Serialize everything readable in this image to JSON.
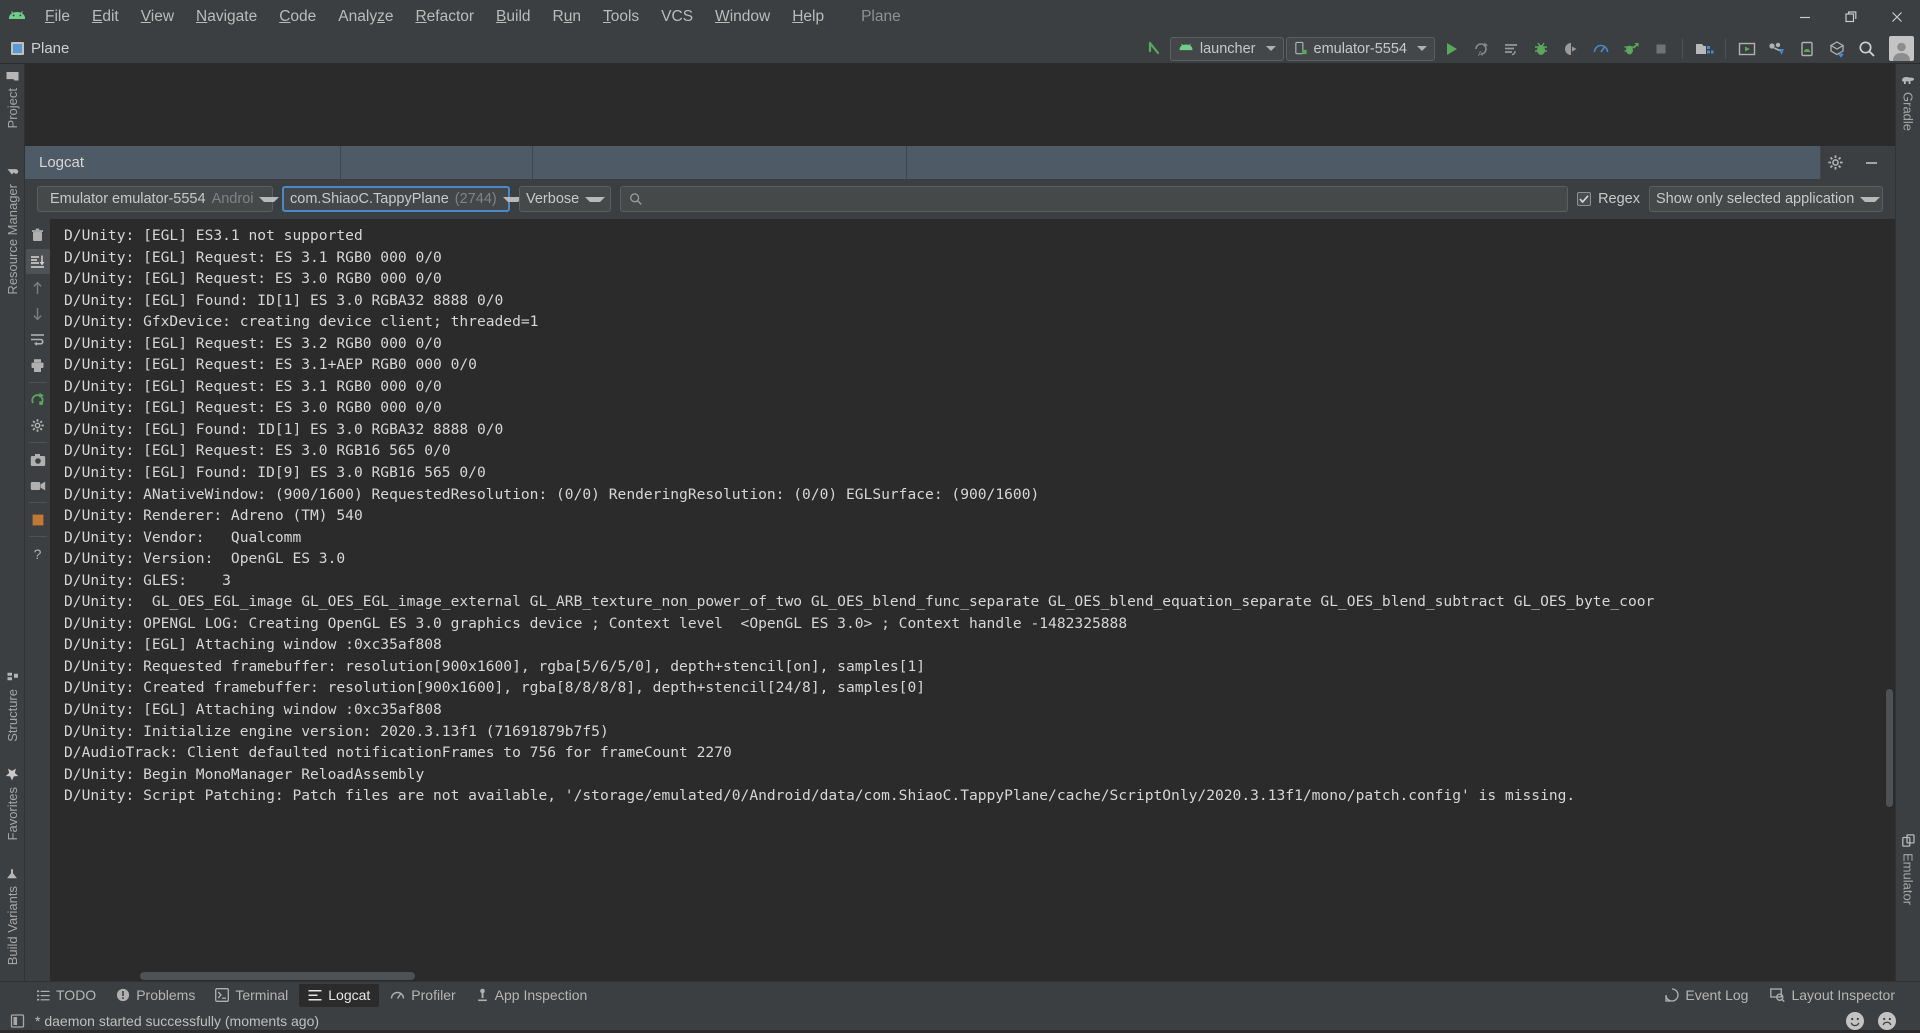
{
  "window": {
    "app_icon": "android-logo-icon",
    "ghost_title": "Plane",
    "controls": {
      "minimize": "minimize-icon",
      "maximize": "restore-icon",
      "close": "close-icon"
    }
  },
  "menubar": {
    "items": [
      {
        "label": "File",
        "mnemonic": "F"
      },
      {
        "label": "Edit",
        "mnemonic": "E"
      },
      {
        "label": "View",
        "mnemonic": "V"
      },
      {
        "label": "Navigate",
        "mnemonic": "N"
      },
      {
        "label": "Code",
        "mnemonic": "C"
      },
      {
        "label": "Analyze",
        "mnemonic": "z"
      },
      {
        "label": "Refactor",
        "mnemonic": "R"
      },
      {
        "label": "Build",
        "mnemonic": "B"
      },
      {
        "label": "Run",
        "mnemonic": "u"
      },
      {
        "label": "Tools",
        "mnemonic": "T"
      },
      {
        "label": "VCS",
        "mnemonic": ""
      },
      {
        "label": "Window",
        "mnemonic": "W"
      },
      {
        "label": "Help",
        "mnemonic": "H"
      }
    ]
  },
  "navbar": {
    "breadcrumb": "Plane",
    "run_config": "launcher",
    "device": "emulator-5554",
    "icons": [
      "back-arrow-icon",
      "run-icon",
      "apply-changes-icon",
      "apply-code-changes-icon",
      "debug-icon",
      "attach-debugger-icon",
      "profiler-icon",
      "run-with-coverage-icon",
      "stop-icon",
      "sdk-manager-icon",
      "avd-manager-icon",
      "layout-editor-icon",
      "device-manager-icon",
      "sync-project-icon",
      "search-everywhere-icon",
      "avatar"
    ]
  },
  "left_strip": {
    "items": [
      {
        "label": "Project",
        "icon": "project-folder-icon"
      },
      {
        "label": "Resource Manager",
        "icon": "resource-manager-icon"
      },
      {
        "label": "Structure",
        "icon": "structure-icon"
      },
      {
        "label": "Favorites",
        "icon": "star-icon"
      },
      {
        "label": "Build Variants",
        "icon": "build-variants-icon"
      }
    ]
  },
  "right_strip": {
    "items": [
      {
        "label": "Gradle",
        "icon": "gradle-elephant-icon"
      },
      {
        "label": "Emulator",
        "icon": "emulator-icon"
      }
    ]
  },
  "logcat": {
    "tab_title": "Logcat",
    "header_icons": [
      "settings-gear-icon",
      "hide-window-icon"
    ],
    "filters": {
      "device": {
        "value": "Emulator emulator-5554",
        "suffix": "Androi",
        "icon": "device-icon"
      },
      "process": {
        "value": "com.ShiaoC.TappyPlane",
        "pid": "(2744)",
        "focused": true
      },
      "level": "Verbose",
      "search_placeholder": "",
      "search_value": "",
      "regex_label": "Regex",
      "regex_checked": true,
      "scope": "Show only selected application"
    },
    "toolbar_icons": [
      "clear-logcat-icon",
      "scroll-to-end-icon",
      "up-the-stack-trace-icon",
      "down-the-stack-trace-icon",
      "soft-wrap-icon",
      "print-icon",
      "restart-logcat-icon",
      "settings-gear-icon",
      "screenshot-icon",
      "screen-record-icon",
      "stop-icon",
      "help-icon"
    ],
    "lines": [
      "D/Unity: [EGL] ES3.1 not supported",
      "D/Unity: [EGL] Request: ES 3.1 RGB0 000 0/0",
      "D/Unity: [EGL] Request: ES 3.0 RGB0 000 0/0",
      "D/Unity: [EGL] Found: ID[1] ES 3.0 RGBA32 8888 0/0",
      "D/Unity: GfxDevice: creating device client; threaded=1",
      "D/Unity: [EGL] Request: ES 3.2 RGB0 000 0/0",
      "D/Unity: [EGL] Request: ES 3.1+AEP RGB0 000 0/0",
      "D/Unity: [EGL] Request: ES 3.1 RGB0 000 0/0",
      "D/Unity: [EGL] Request: ES 3.0 RGB0 000 0/0",
      "D/Unity: [EGL] Found: ID[1] ES 3.0 RGBA32 8888 0/0",
      "D/Unity: [EGL] Request: ES 3.0 RGB16 565 0/0",
      "D/Unity: [EGL] Found: ID[9] ES 3.0 RGB16 565 0/0",
      "D/Unity: ANativeWindow: (900/1600) RequestedResolution: (0/0) RenderingResolution: (0/0) EGLSurface: (900/1600)",
      "D/Unity: Renderer: Adreno (TM) 540",
      "D/Unity: Vendor:   Qualcomm",
      "D/Unity: Version:  OpenGL ES 3.0",
      "D/Unity: GLES:    3",
      "D/Unity:  GL_OES_EGL_image GL_OES_EGL_image_external GL_ARB_texture_non_power_of_two GL_OES_blend_func_separate GL_OES_blend_equation_separate GL_OES_blend_subtract GL_OES_byte_coor",
      "D/Unity: OPENGL LOG: Creating OpenGL ES 3.0 graphics device ; Context level  <OpenGL ES 3.0> ; Context handle -1482325888",
      "D/Unity: [EGL] Attaching window :0xc35af808",
      "D/Unity: Requested framebuffer: resolution[900x1600], rgba[5/6/5/0], depth+stencil[on], samples[1]",
      "D/Unity: Created framebuffer: resolution[900x1600], rgba[8/8/8/8], depth+stencil[24/8], samples[0]",
      "D/Unity: [EGL] Attaching window :0xc35af808",
      "D/Unity: Initialize engine version: 2020.3.13f1 (71691879b7f5)",
      "D/AudioTrack: Client defaulted notificationFrames to 756 for frameCount 2270",
      "D/Unity: Begin MonoManager ReloadAssembly",
      "D/Unity: Script Patching: Patch files are not available, '/storage/emulated/0/Android/data/com.ShiaoC.TappyPlane/cache/ScriptOnly/2020.3.13f1/mono/patch.config' is missing."
    ]
  },
  "tool_window_bar": {
    "left": [
      {
        "label": "TODO",
        "icon": "todo-icon",
        "active": false
      },
      {
        "label": "Problems",
        "icon": "problems-icon",
        "active": false
      },
      {
        "label": "Terminal",
        "icon": "terminal-icon",
        "active": false
      },
      {
        "label": "Logcat",
        "icon": "logcat-icon",
        "active": true
      },
      {
        "label": "Profiler",
        "icon": "profiler-icon",
        "active": false
      },
      {
        "label": "App Inspection",
        "icon": "app-inspection-icon",
        "active": false
      }
    ],
    "right": [
      {
        "label": "Event Log",
        "icon": "event-log-icon"
      },
      {
        "label": "Layout Inspector",
        "icon": "layout-inspector-icon"
      }
    ]
  },
  "statusbar": {
    "icon": "toggle-toolbar-icon",
    "message": "* daemon started successfully (moments ago)",
    "feedback": [
      "happy-face-icon",
      "sad-face-icon"
    ]
  },
  "colors": {
    "chrome": "#3c3f41",
    "editor_bg": "#2b2b2b",
    "tab_active": "#4e5a65",
    "accent_blue": "#4a88c7",
    "accent_green": "#5aa85a",
    "text": "#bbbbbb",
    "stop_orange": "#c07832"
  }
}
